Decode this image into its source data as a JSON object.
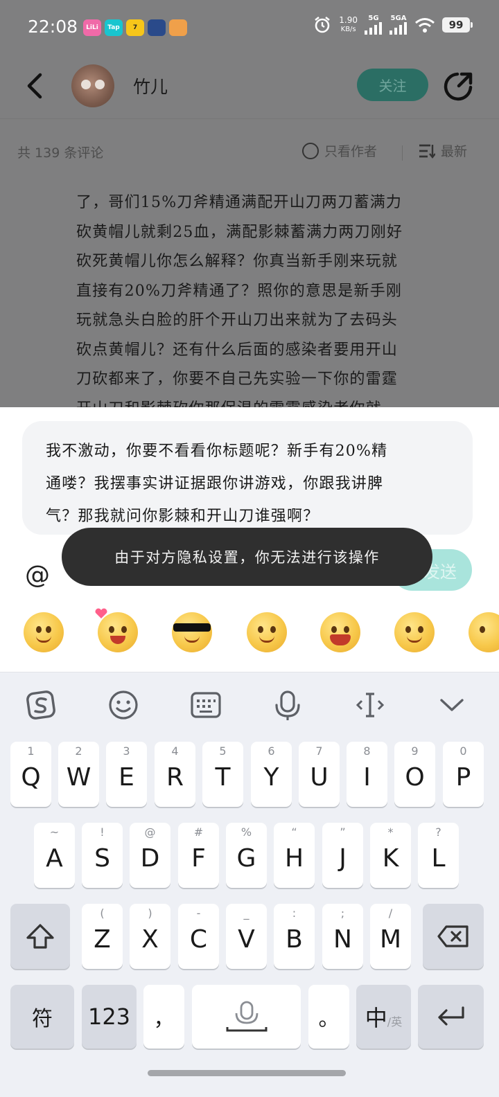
{
  "status_bar": {
    "time": "22:08",
    "apps": [
      {
        "label": "LiLi",
        "color": "#f06aa8"
      },
      {
        "label": "Tap",
        "color": "#19c5cf"
      },
      {
        "label": "7",
        "color": "#f7c61a"
      },
      {
        "label": "",
        "color": "#2a4a8a"
      },
      {
        "label": "",
        "color": "#f0a04a"
      }
    ],
    "net_speed_value": "1.90",
    "net_speed_unit": "KB/s",
    "signal_1": "5G",
    "signal_2": "5GA",
    "battery": "99"
  },
  "header": {
    "username": "竹儿",
    "follow_label": "关注",
    "accent_color": "#2b6e64"
  },
  "comment_bar": {
    "count_text": "共 139 条评论",
    "only_author": "只看作者",
    "sort_label": "最新"
  },
  "comment": {
    "lines": [
      "了，哥们15%刀斧精通满配开山刀两刀蓄满力",
      "砍黄帽儿就剩25血，满配影棘蓄满力两刀刚好",
      "砍死黄帽儿你怎么解释？你真当新手刚来玩就",
      "直接有20%刀斧精通了？照你的意思是新手刚",
      "玩就急头白脸的肝个开山刀出来就为了去码头",
      "砍点黄帽儿？还有什么后面的感染者要用开山",
      "刀砍都来了，你要不自己先实验一下你的雷霆",
      "开山刀和影棘砍你那保温的雷霆感染者你就"
    ]
  },
  "reply": {
    "lines": [
      "我不激动，你要不看看你标题呢？新手有20%精",
      "通喽？我摆事实讲证据跟你讲游戏，你跟我讲脾",
      "气？那我就问你影棘和开山刀谁强啊？"
    ],
    "at_symbol": "@",
    "send_label": "发送"
  },
  "toast": {
    "message": "由于对方隐私设置，你无法进行该操作"
  },
  "keyboard": {
    "row1": [
      {
        "main": "Q",
        "sub": "1"
      },
      {
        "main": "W",
        "sub": "2"
      },
      {
        "main": "E",
        "sub": "3"
      },
      {
        "main": "R",
        "sub": "4"
      },
      {
        "main": "T",
        "sub": "5"
      },
      {
        "main": "Y",
        "sub": "6"
      },
      {
        "main": "U",
        "sub": "7"
      },
      {
        "main": "I",
        "sub": "8"
      },
      {
        "main": "O",
        "sub": "9"
      },
      {
        "main": "P",
        "sub": "0"
      }
    ],
    "row2": [
      {
        "main": "A",
        "sub": "~"
      },
      {
        "main": "S",
        "sub": "!"
      },
      {
        "main": "D",
        "sub": "@"
      },
      {
        "main": "F",
        "sub": "#"
      },
      {
        "main": "G",
        "sub": "%"
      },
      {
        "main": "H",
        "sub": "“"
      },
      {
        "main": "J",
        "sub": "”"
      },
      {
        "main": "K",
        "sub": "*"
      },
      {
        "main": "L",
        "sub": "?"
      }
    ],
    "row3": [
      {
        "main": "Z",
        "sub": "("
      },
      {
        "main": "X",
        "sub": ")"
      },
      {
        "main": "C",
        "sub": "-"
      },
      {
        "main": "V",
        "sub": "_"
      },
      {
        "main": "B",
        "sub": ":"
      },
      {
        "main": "N",
        "sub": ";"
      },
      {
        "main": "M",
        "sub": "/"
      }
    ],
    "symbols_label": "符",
    "numbers_label": "123",
    "comma": "，",
    "period": "。",
    "lang_main": "中",
    "lang_sub": "/英"
  }
}
